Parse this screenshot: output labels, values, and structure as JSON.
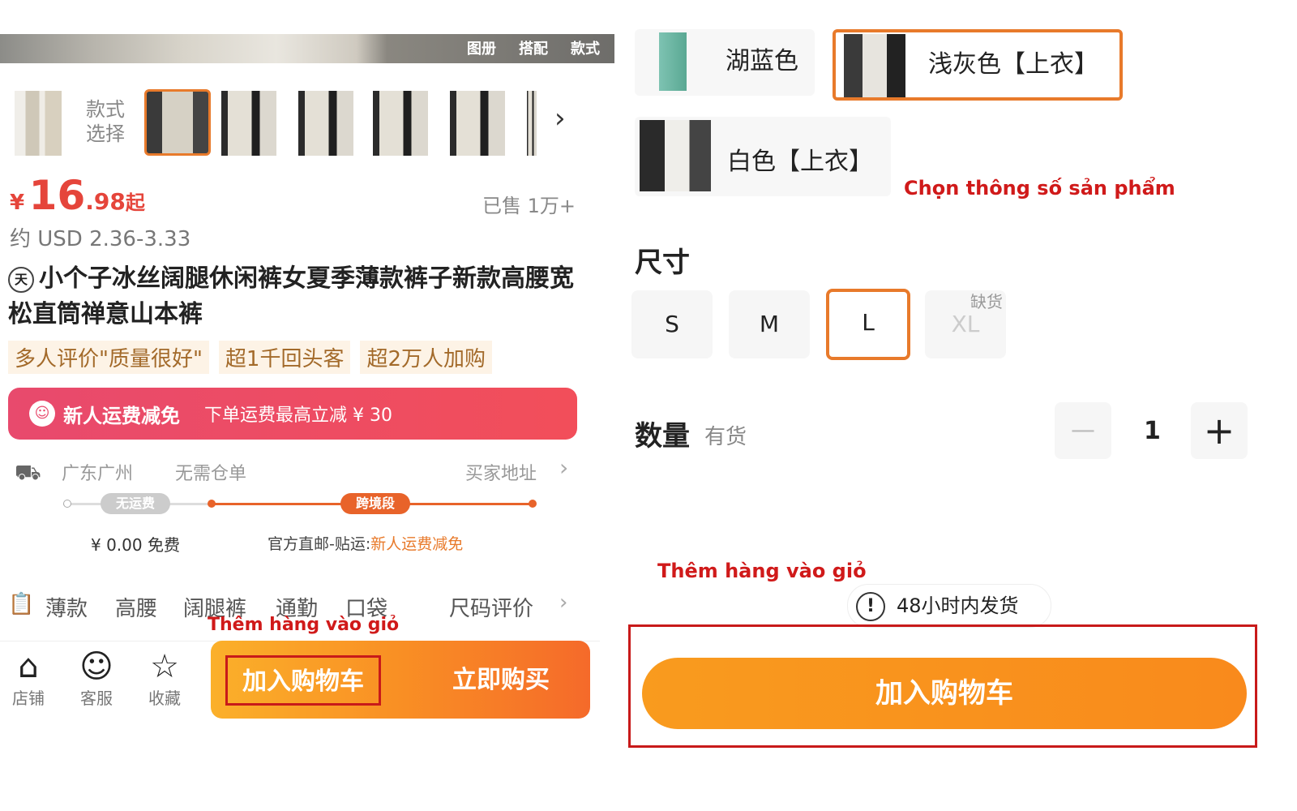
{
  "left": {
    "banner_tags": [
      "图册",
      "搭配",
      "款式"
    ],
    "style_label": "款式选择",
    "price": {
      "currency": "¥",
      "integer": "16",
      "decimal": ".98",
      "suffix": "起"
    },
    "sold": "已售 1万+",
    "usd": "约 USD 2.36-3.33",
    "title": "小个子冰丝阔腿休闲裤女夏季薄款裤子新款高腰宽松直筒禅意山本裤",
    "brand_icon": "天",
    "tags": [
      "多人评价\"质量很好\"",
      "超1千回头客",
      "超2万人加购"
    ],
    "promo": {
      "icon": "☺",
      "title": "新人运费减免",
      "text": "下单运费最高立减 ¥ 30"
    },
    "shipping": {
      "origin": "广东广州",
      "warehouse": "无需仓单",
      "address": "买家地址",
      "leg1": "无运费",
      "leg2": "跨境段",
      "fee": "¥ 0.00 免费",
      "official_prefix": "官方直邮-贴运:",
      "official_highlight": "新人运费减免"
    },
    "attributes": [
      "薄款",
      "高腰",
      "阔腿裤",
      "通勤",
      "口袋"
    ],
    "size_review": "尺码评价",
    "annotation": "Thêm hàng vào giỏ",
    "toolbar": {
      "shop": "店铺",
      "service": "客服",
      "favorite": "收藏"
    },
    "add_to_cart": "加入购物车",
    "buy_now": "立即购买"
  },
  "right": {
    "color_options": [
      {
        "label": "湖蓝色",
        "selected": false
      },
      {
        "label": "浅灰色【上衣】",
        "selected": true
      },
      {
        "label": "白色【上衣】",
        "selected": false
      }
    ],
    "annotation_choose": "Chọn thông số sản phẩm",
    "size_label": "尺寸",
    "sizes": [
      {
        "label": "S",
        "state": "normal"
      },
      {
        "label": "M",
        "state": "normal"
      },
      {
        "label": "L",
        "state": "selected"
      },
      {
        "label": "XL",
        "state": "disabled"
      }
    ],
    "out_of_stock": "缺货",
    "qty_label": "数量",
    "qty_status": "有货",
    "qty_minus": "—",
    "qty_value": "1",
    "qty_plus": "+",
    "annotation_add": "Thêm hàng vào giỏ",
    "ship_notice": "48小时内发货",
    "notice_icon": "!",
    "add_to_cart": "加入购物车"
  },
  "colors": {
    "accent": "#e87a2b",
    "price": "#e5453b",
    "annotation": "#d01a1a",
    "promo": "#e84a6d",
    "button_orange": "#f98f24"
  }
}
